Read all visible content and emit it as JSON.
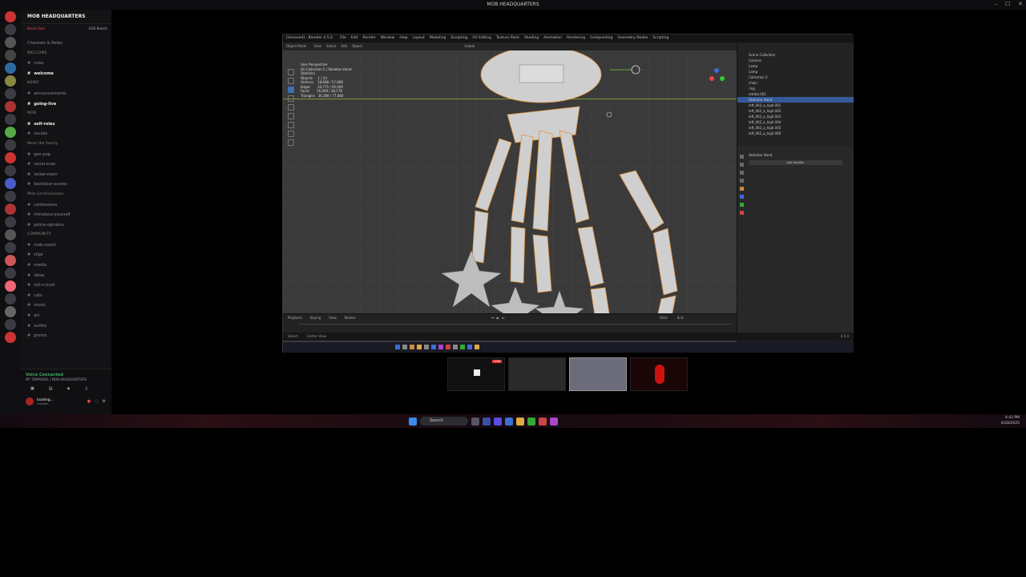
{
  "window": {
    "title": "MOB HEADQUARTERS"
  },
  "discord": {
    "server_name": "MOB HEADQUARTERS",
    "boost_text": "Boost Goal",
    "boost_count": "4/20 Boosts",
    "channels": [
      {
        "label": "Channels & Roles",
        "type": "item"
      },
      {
        "label": "WELCOME",
        "type": "cat"
      },
      {
        "label": "rules",
        "type": "text"
      },
      {
        "label": "welcome",
        "type": "text",
        "bold": true
      },
      {
        "label": "NEWS",
        "type": "cat"
      },
      {
        "label": "announcements",
        "type": "text"
      },
      {
        "label": "going-live",
        "type": "text",
        "bold": true
      },
      {
        "label": "MOB",
        "type": "cat"
      },
      {
        "label": "self-roles",
        "type": "text",
        "bold": true
      },
      {
        "label": "socials",
        "type": "text"
      },
      {
        "label": "Meet the family",
        "type": "cat"
      },
      {
        "label": "gen-pop",
        "type": "text"
      },
      {
        "label": "racial-scan",
        "type": "text"
      },
      {
        "label": "locker-room",
        "type": "text"
      },
      {
        "label": "backdoor-access",
        "type": "text"
      },
      {
        "label": "Mob Confessionals",
        "type": "cat"
      },
      {
        "label": "confessions",
        "type": "text"
      },
      {
        "label": "introduce-yourself",
        "type": "text"
      },
      {
        "label": "police-opinions",
        "type": "text"
      },
      {
        "label": "COMMUNITY",
        "type": "cat"
      },
      {
        "label": "mob-vouch",
        "type": "text"
      },
      {
        "label": "clips",
        "type": "text"
      },
      {
        "label": "media",
        "type": "text"
      },
      {
        "label": "ideas",
        "type": "text"
      },
      {
        "label": "roll-n-trust",
        "type": "text"
      },
      {
        "label": "cats",
        "type": "text"
      },
      {
        "label": "music",
        "type": "text"
      },
      {
        "label": "art",
        "type": "text"
      },
      {
        "label": "outfits",
        "type": "text"
      },
      {
        "label": "promo",
        "type": "text"
      }
    ],
    "voice_status": "Voice Connected",
    "voice_channel": "MY TEMPORAL / MOB HEADQUARTERS",
    "user_name": "loading...",
    "user_status": "Invisible"
  },
  "taskbar": {
    "search_placeholder": "Search",
    "time": "4:43 PM",
    "date": "6/28/2025"
  },
  "blender": {
    "title": "[Unsaved] - Blender 4.5.0",
    "menus": [
      "File",
      "Edit",
      "Render",
      "Window",
      "Help",
      "Layout",
      "Modeling",
      "Sculpting",
      "UV Editing",
      "Texture Paint",
      "Shading",
      "Animation",
      "Rendering",
      "Compositing",
      "Geometry Nodes",
      "Scripting"
    ],
    "mode": "Object Mode",
    "header_items": [
      "View",
      "Select",
      "Add",
      "Object"
    ],
    "view_label": "Global",
    "stats": [
      "User Perspective",
      "(0) Collection 5 | Skeleton Hand",
      "Statistics",
      "Objects     1 / 24",
      "Vertices    18,688 / 57,868",
      "Edges       34,775 / 95,009",
      "Faces       16,008 / 38,178",
      "Triangles   36,308 / 77,880"
    ],
    "outliner_items": [
      {
        "label": "Scene Collection",
        "sel": false
      },
      {
        "label": "Camera",
        "sel": false
      },
      {
        "label": "Lamp",
        "sel": false
      },
      {
        "label": "Lamp",
        "sel": false
      },
      {
        "label": "Collection 5",
        "sel": false
      },
      {
        "label": "chain",
        "sel": false
      },
      {
        "label": "ring",
        "sel": false
      },
      {
        "label": "orbital.001",
        "sel": false
      },
      {
        "label": "Skeleton Hand",
        "sel": true
      },
      {
        "label": "left_002_a_high.001",
        "sel": false
      },
      {
        "label": "left_002_a_high.002",
        "sel": false
      },
      {
        "label": "left_002_a_high.003",
        "sel": false
      },
      {
        "label": "left_002_a_high.004",
        "sel": false
      },
      {
        "label": "left_002_a_high.005",
        "sel": false
      },
      {
        "label": "left_002_a_high.006",
        "sel": false
      }
    ],
    "props_title": "Skeleton Hand",
    "props_button": "Add Modifier",
    "timeline_labels": [
      "Playback",
      "Keying",
      "View",
      "Marker"
    ],
    "timeline_start": "Start",
    "timeline_end": "End",
    "status_left": "Select",
    "status_mid": "Center View",
    "version": "4.5.0"
  },
  "colors": {
    "accent": "#3f6fb5",
    "selection": "#345a9a",
    "bone": "#cfcfcf",
    "outline": "#e0923a"
  }
}
